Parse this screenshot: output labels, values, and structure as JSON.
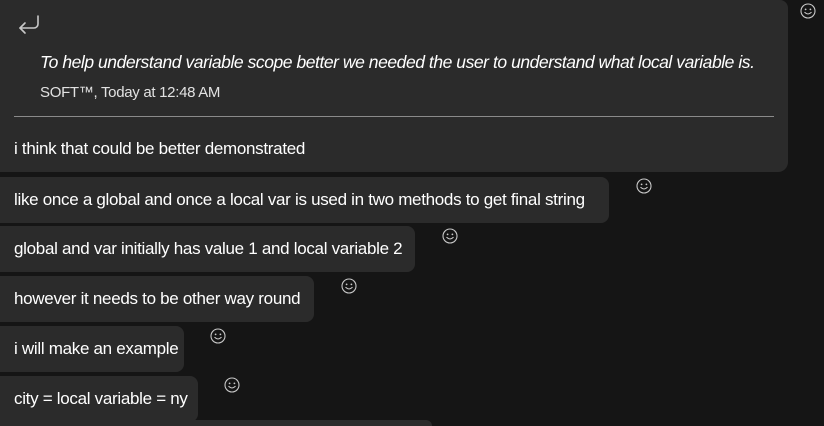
{
  "reply": {
    "quote_text": "To help understand variable scope better we needed the user to understand what local variable is.",
    "quote_meta": "SOFT™, Today at 12:48 AM",
    "text": "i think that could be better demonstrated"
  },
  "messages": [
    {
      "text": "like once a global and once a local var is used in two methods to get final string"
    },
    {
      "text": "global and var initially has value 1 and local variable 2"
    },
    {
      "text": "however it needs to be other way round"
    },
    {
      "text": "i will make an example"
    },
    {
      "text": "city = local variable = ny"
    }
  ],
  "icons": {
    "reply": "reply-arrow-icon",
    "reaction": "smiley-face-icon"
  },
  "colors": {
    "background": "#151515",
    "bubble": "#2b2b2b",
    "text": "#ffffff",
    "icon": "#c8c8c8",
    "divider": "#8a8a8a"
  }
}
